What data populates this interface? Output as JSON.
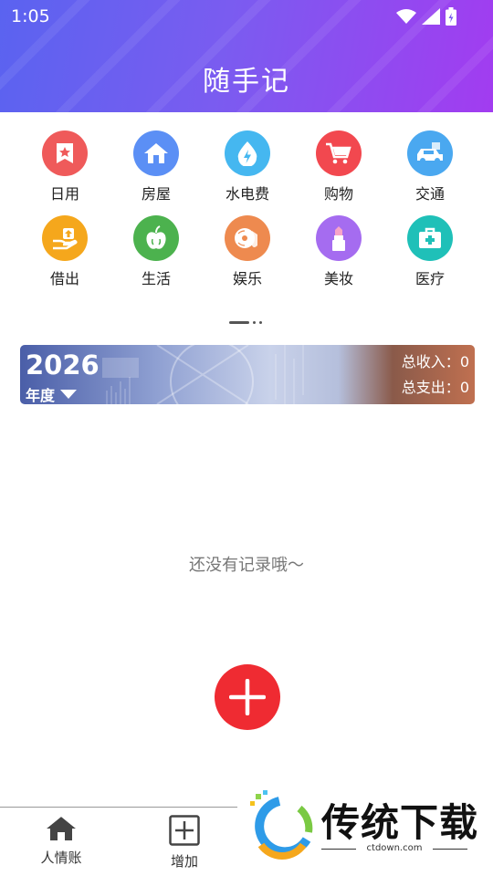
{
  "status_bar": {
    "time": "1:05",
    "icons": [
      "wifi-icon",
      "signal-icon",
      "battery-icon"
    ]
  },
  "header": {
    "title": "随手记",
    "accent_colors": [
      "#5a63f0",
      "#a23cf0"
    ]
  },
  "categories": [
    {
      "label": "日用",
      "icon": "star-bookmark-icon",
      "color": "#ef5a5a"
    },
    {
      "label": "房屋",
      "icon": "house-icon",
      "color": "#5b8ff5"
    },
    {
      "label": "水电费",
      "icon": "water-drop-bolt-icon",
      "color": "#45b7f0"
    },
    {
      "label": "购物",
      "icon": "shopping-cart-icon",
      "color": "#f2484f"
    },
    {
      "label": "交通",
      "icon": "car-icon",
      "color": "#4aa8f0"
    },
    {
      "label": "借出",
      "icon": "hand-upload-icon",
      "color": "#f5a71c"
    },
    {
      "label": "生活",
      "icon": "apple-icon",
      "color": "#4cb24e"
    },
    {
      "label": "娱乐",
      "icon": "music-disc-icon",
      "color": "#ee8a4f"
    },
    {
      "label": "美妆",
      "icon": "lipstick-icon",
      "color": "#a56cf0"
    },
    {
      "label": "医疗",
      "icon": "medical-kit-icon",
      "color": "#1fc0b8"
    }
  ],
  "banner": {
    "year": "2026",
    "period": "年度",
    "income_label": "总收入：",
    "income_value": "0",
    "expense_label": "总支出：",
    "expense_value": "0"
  },
  "empty_state": {
    "text": "还没有记录哦～"
  },
  "fab": {
    "icon": "plus-icon",
    "color": "#ef2b32"
  },
  "bottom_nav": [
    {
      "label": "人情账",
      "icon": "home-icon"
    },
    {
      "label": "增加",
      "icon": "add-square-icon"
    }
  ],
  "watermark": {
    "text": "传统下载",
    "url": "ctdown.com"
  }
}
